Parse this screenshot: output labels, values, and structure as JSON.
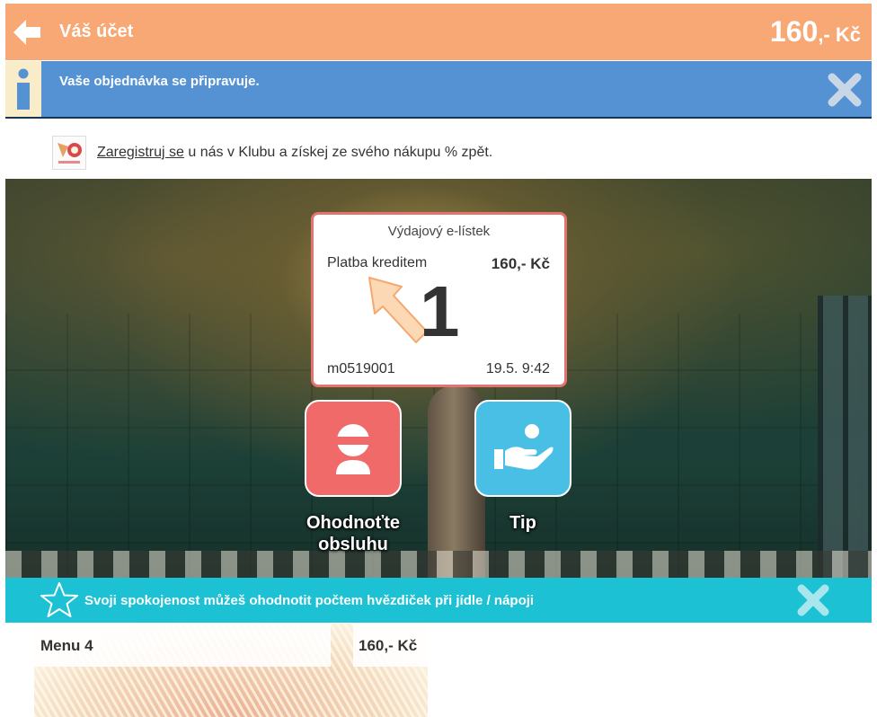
{
  "header": {
    "title": "Váš účet",
    "total_amount": "160",
    "total_suffix": ",- Kč"
  },
  "info": {
    "message": "Vaše objednávka se připravuje."
  },
  "register": {
    "link_text": "Zaregistruj se",
    "rest_text": " u nás v Klubu a získej ze svého nákupu % zpět."
  },
  "receipt": {
    "title": "Výdajový e-lístek",
    "payment_method": "Platba kreditem",
    "amount": "160,- Kč",
    "order_number": "1",
    "order_id": "m0519001",
    "datetime": "19.5. 9:42"
  },
  "actions": {
    "rate_label_line1": "Ohodnoťte",
    "rate_label_line2": "obsluhu",
    "tip_label": "Tip"
  },
  "rating": {
    "message": "Svoji spokojenost můžeš ohodnotit počtem hvězdiček při jídle / nápoji"
  },
  "menu_items": [
    {
      "name": "Menu 4",
      "price": "160,- Kč"
    }
  ],
  "colors": {
    "header": "#f8a874",
    "info": "#5592d4",
    "receipt_border": "#e37470",
    "rate_button": "#f06a6a",
    "tip_button": "#49bfe6",
    "rating_bar": "#1cc1d4"
  }
}
